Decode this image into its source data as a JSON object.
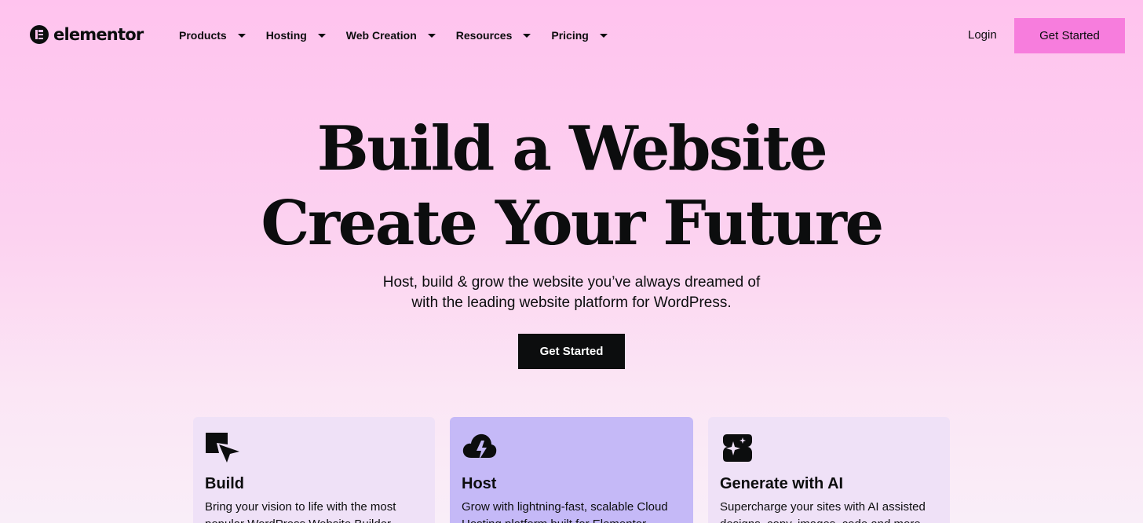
{
  "brand": {
    "name": "elementor"
  },
  "nav": {
    "items": [
      {
        "label": "Products"
      },
      {
        "label": "Hosting"
      },
      {
        "label": "Web Creation"
      },
      {
        "label": "Resources"
      },
      {
        "label": "Pricing"
      }
    ],
    "login_label": "Login",
    "cta_label": "Get Started"
  },
  "hero": {
    "title_line1": "Build a Website",
    "title_line2": "Create Your Future",
    "subtitle_line1": "Host, build & grow the website you’ve always dreamed of",
    "subtitle_line2": "with the leading website platform for WordPress.",
    "cta_label": "Get Started"
  },
  "cards": [
    {
      "icon": "build-icon",
      "title": "Build",
      "text": "Bring your vision to life with the most popular WordPress Website Builder"
    },
    {
      "icon": "cloud-bolt-icon",
      "title": "Host",
      "text": "Grow with lightning-fast, scalable Cloud Hosting platform built for Elementor"
    },
    {
      "icon": "ai-sparkle-icon",
      "title": "Generate with AI",
      "text": "Supercharge your sites with AI assisted designs, copy, images, code and more"
    }
  ],
  "colors": {
    "accent": "#f77ddd",
    "dark": "#0c0d0e",
    "card_light": "#efe1f7",
    "card_highlight": "#c5b9f7"
  }
}
